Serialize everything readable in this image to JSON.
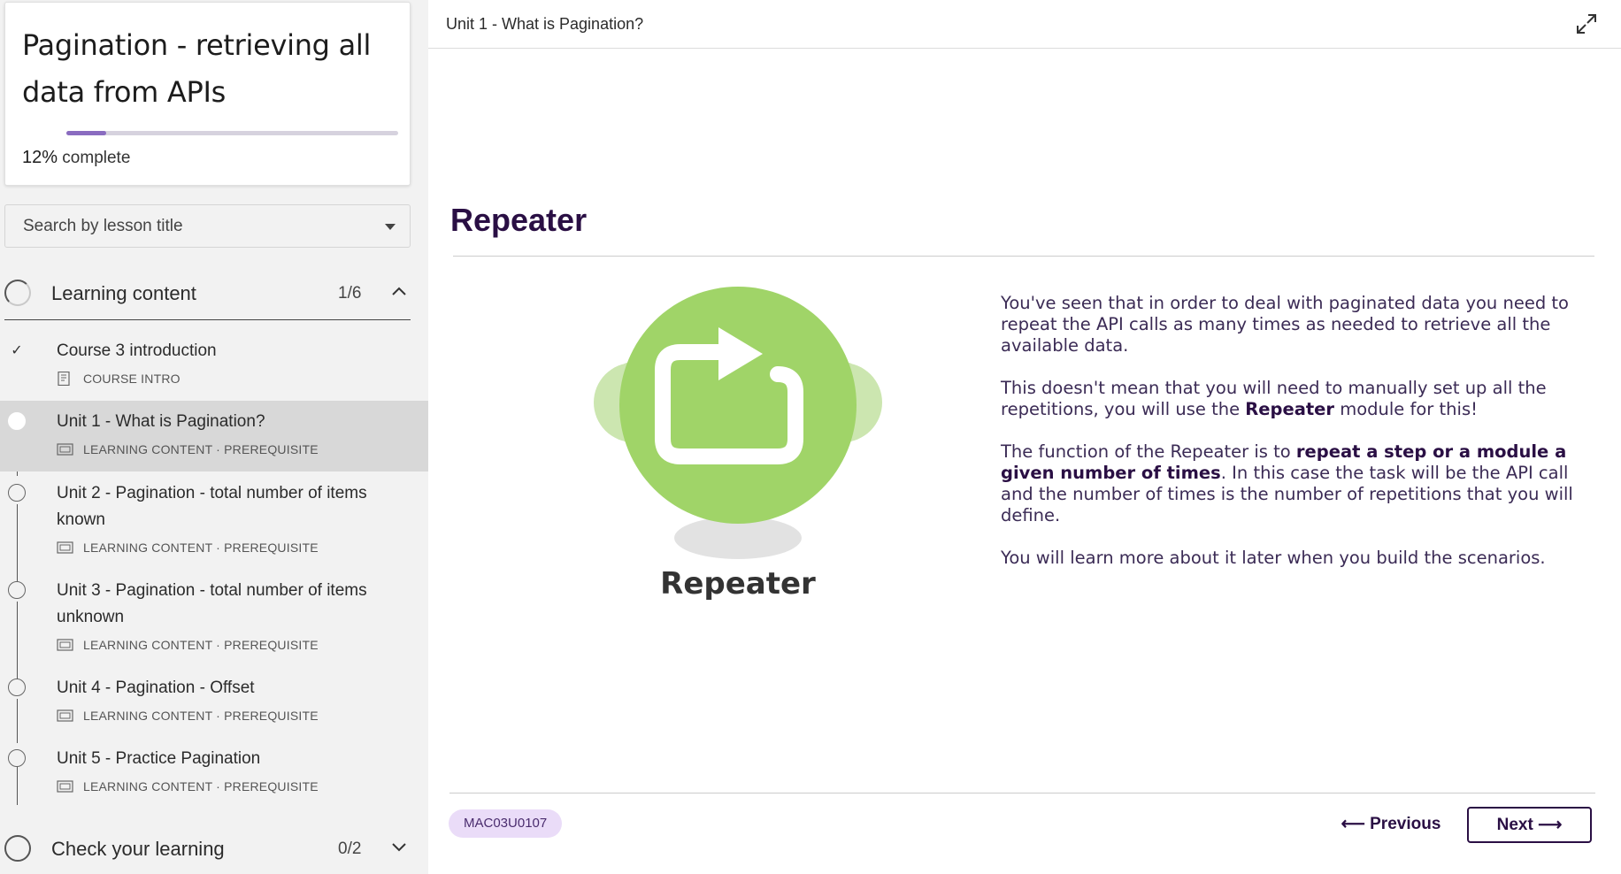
{
  "sidebar": {
    "course_title": "Pagination - retrieving all data from APIs",
    "progress_percent": 12,
    "progress_pct_label": "12%",
    "progress_suffix": " complete",
    "search_placeholder": "Search by lesson title",
    "sections": [
      {
        "label": "Learning content",
        "count": "1/6",
        "expanded": true,
        "lessons": [
          {
            "title": "Course 3 introduction",
            "meta": "COURSE INTRO",
            "state": "completed"
          },
          {
            "title": "Unit 1 - What is Pagination?",
            "meta": "LEARNING CONTENT · PREREQUISITE",
            "state": "active"
          },
          {
            "title": "Unit 2 - Pagination - total number of items known",
            "meta": "LEARNING CONTENT · PREREQUISITE",
            "state": "todo"
          },
          {
            "title": "Unit 3 - Pagination - total number of items unknown",
            "meta": "LEARNING CONTENT · PREREQUISITE",
            "state": "todo"
          },
          {
            "title": "Unit 4 - Pagination - Offset",
            "meta": "LEARNING CONTENT · PREREQUISITE",
            "state": "todo"
          },
          {
            "title": "Unit 5 - Practice Pagination",
            "meta": "LEARNING CONTENT · PREREQUISITE",
            "state": "todo"
          }
        ]
      },
      {
        "label": "Check your learning",
        "count": "0/2",
        "expanded": false
      }
    ]
  },
  "main": {
    "breadcrumb": "Unit 1 - What is Pagination?",
    "heading": "Repeater",
    "illustration_caption": "Repeater",
    "paragraphs": {
      "p1": "You've seen that in order to deal with paginated data you need to repeat the API calls as many times as needed to retrieve all the available data.",
      "p2_before": "This doesn't mean that you will need to manually set up all the repetitions, you will use the ",
      "p2_bold": "Repeater",
      "p2_after": " module for this!",
      "p3_before": "The function of the Repeater is to ",
      "p3_bold": "repeat a step or a module a given number of times",
      "p3_after": ". In this case the task will be the API call and the number of times is the number of repetitions that you will define.",
      "p4": "You will learn more about it later when you build the scenarios."
    },
    "lesson_code": "MAC03U0107",
    "prev_label": "Previous",
    "next_label": "Next"
  },
  "colors": {
    "brand_purple": "#2a0f44",
    "repeater_green": "#a0d468",
    "repeater_green_light": "#cce6b0",
    "badge_bg": "#eadcf8",
    "active_row": "#d8d8d8"
  },
  "icons": {
    "check": "checkmark-icon",
    "caret": "caret-down-icon",
    "chevron_up": "chevron-up-icon",
    "chevron_down": "chevron-down-icon",
    "expand": "expand-icon",
    "arrow_left": "arrow-left-icon",
    "arrow_right": "arrow-right-icon"
  }
}
